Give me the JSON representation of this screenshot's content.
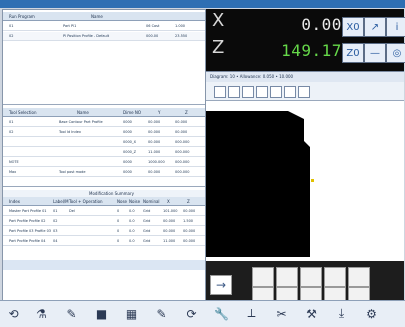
{
  "window": {
    "title": ""
  },
  "table1": {
    "headers": [
      "Run Program",
      "Name",
      "",
      ""
    ],
    "rows": [
      [
        "01",
        "Part Pl1",
        "06 Cost",
        "1.000"
      ],
      [
        "02",
        "Pl Position Profile - Default",
        "000.00",
        "23.550"
      ]
    ]
  },
  "table2": {
    "headers": [
      "Tool Selection",
      "Name",
      "Dime NO",
      "Y",
      "Z"
    ],
    "rows": [
      [
        "01",
        "Base Contour Part Profile",
        "0000",
        "00.000",
        "00.000"
      ],
      [
        "02",
        "Tool Id Index",
        "0000",
        "00.000",
        "00.000"
      ],
      [
        "",
        "",
        "0000_X",
        "00.000",
        "000.000"
      ],
      [
        "",
        "",
        "0000_Z",
        "11.000",
        "000.000"
      ],
      [
        "NOTE",
        "",
        "0000",
        "1000.000",
        "000.000"
      ],
      [
        "Max",
        "Tool post mode",
        "0000",
        "00.000",
        "000.000"
      ]
    ]
  },
  "table3": {
    "title": "Modification Summary",
    "headers": [
      "Index",
      "Label/M",
      "Tool + Operation",
      "Nose",
      "Noise",
      "Nominal",
      "X",
      "Z"
    ],
    "rows": [
      [
        "Master Part Profile 01",
        "01",
        "Del",
        "0",
        "0.0",
        "Grid",
        "101.000",
        "00.000"
      ],
      [
        "Part Profile Profile 02",
        "02",
        "",
        "0",
        "0.0",
        "Grid",
        "00.000",
        "1.500"
      ],
      [
        "Part Profile 03 Profile 03",
        "03",
        "",
        "0",
        "0.0",
        "Grid",
        "00.000",
        "00.000"
      ],
      [
        "Part Profile Profile 04",
        "04",
        "",
        "0",
        "0.0",
        "Grid",
        "11.000",
        "00.000"
      ]
    ]
  },
  "dro": {
    "x_label": "X",
    "x_value": "0.000",
    "z_label": "Z",
    "z_value": "149.177",
    "status_text": "Diagram: 10 • Allowance: 0.050 • 10.000"
  },
  "dro_buttons": [
    {
      "name": "x-zero-button",
      "icon": "X0",
      "label": ""
    },
    {
      "name": "x-arrow-button",
      "icon": "arrow-up-right-icon",
      "label": ""
    },
    {
      "name": "x-info-button",
      "icon": "info-icon",
      "label": ""
    },
    {
      "name": "z-zero-button",
      "icon": "Z0",
      "label": ""
    },
    {
      "name": "z-minus-button",
      "icon": "minus-icon",
      "label": ""
    },
    {
      "name": "z-target-button",
      "icon": "target-icon",
      "label": ""
    }
  ],
  "thumbnails": {
    "arrow": "→",
    "items": 10
  },
  "bottom_toolbar": [
    {
      "name": "undo-icon",
      "label": ""
    },
    {
      "name": "flask-icon",
      "label": ""
    },
    {
      "name": "pencil-icon",
      "label": ""
    },
    {
      "name": "stop-icon",
      "label": ""
    },
    {
      "name": "grid-icon",
      "label": ""
    },
    {
      "name": "brush-icon",
      "label": ""
    },
    {
      "name": "rotate-icon",
      "label": ""
    },
    {
      "name": "wrench-icon",
      "label": ""
    },
    {
      "name": "measure-icon",
      "label": ""
    },
    {
      "name": "cut-icon",
      "label": ""
    },
    {
      "name": "tool-icon",
      "label": ""
    },
    {
      "name": "download-icon",
      "label": ""
    },
    {
      "name": "settings-icon",
      "label": ""
    }
  ]
}
